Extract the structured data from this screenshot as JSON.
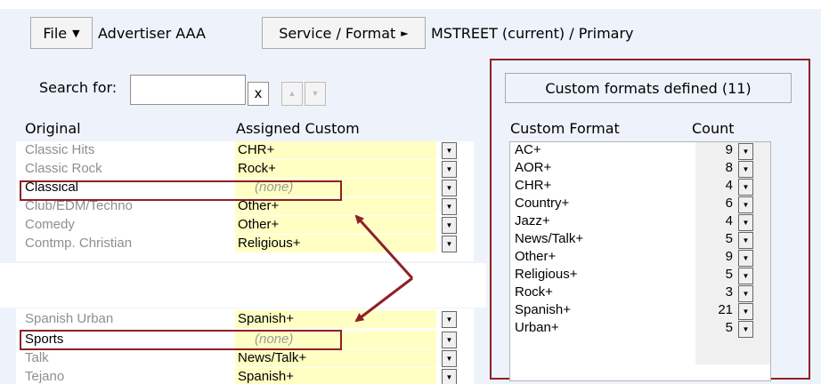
{
  "toolbar": {
    "file_label": "File",
    "advertiser": "Advertiser AAA",
    "service_format_label": "Service / Format",
    "station": "MSTREET (current) / Primary"
  },
  "search": {
    "label": "Search for:",
    "value": "",
    "clear_label": "x"
  },
  "columns": {
    "original": "Original",
    "assigned": "Assigned Custom"
  },
  "mapping_rows_top": [
    {
      "original": "Classic Hits",
      "assigned": "CHR+"
    },
    {
      "original": "Classic Rock",
      "assigned": "Rock+"
    },
    {
      "original": "Classical",
      "assigned": "(none)"
    },
    {
      "original": "Club/EDM/Techno",
      "assigned": "Other+"
    },
    {
      "original": "Comedy",
      "assigned": "Other+"
    },
    {
      "original": "Contmp. Christian",
      "assigned": "Religious+"
    }
  ],
  "mapping_rows_bottom": [
    {
      "original": "Spanish Urban",
      "assigned": "Spanish+"
    },
    {
      "original": "Sports",
      "assigned": "(none)"
    },
    {
      "original": "Talk",
      "assigned": "News/Talk+"
    },
    {
      "original": "Tejano",
      "assigned": "Spanish+"
    }
  ],
  "custom_formats": {
    "header": "Custom formats defined (11)",
    "col_format": "Custom Format",
    "col_count": "Count",
    "items": [
      {
        "name": "AC+",
        "count": "9"
      },
      {
        "name": "AOR+",
        "count": "8"
      },
      {
        "name": "CHR+",
        "count": "4"
      },
      {
        "name": "Country+",
        "count": "6"
      },
      {
        "name": "Jazz+",
        "count": "4"
      },
      {
        "name": "News/Talk+",
        "count": "5"
      },
      {
        "name": "Other+",
        "count": "9"
      },
      {
        "name": "Religious+",
        "count": "5"
      },
      {
        "name": "Rock+",
        "count": "3"
      },
      {
        "name": "Spanish+",
        "count": "21"
      },
      {
        "name": "Urban+",
        "count": "5"
      }
    ]
  },
  "colors": {
    "annotation": "#8e2026",
    "assigned_bg": "#ffffc4",
    "panel_bg": "#eef3fb"
  }
}
